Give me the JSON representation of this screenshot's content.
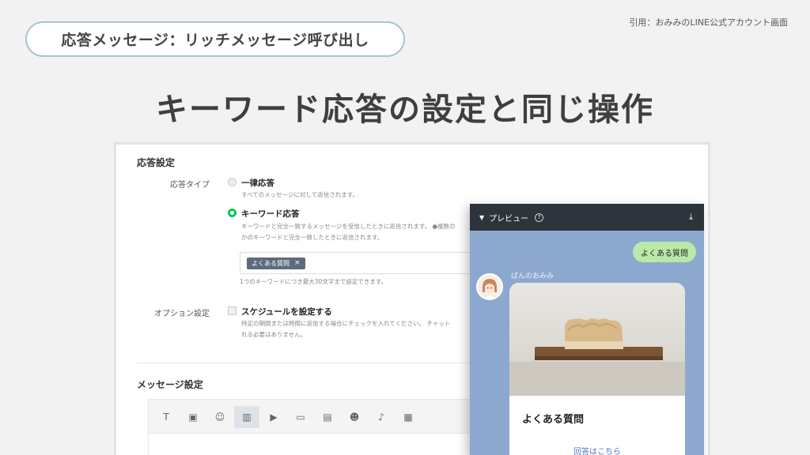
{
  "slide": {
    "pill_text": "応答メッセージ：リッチメッセージ呼び出し",
    "citation": "引用：おみみのLINE公式アカウント画面",
    "headline": "キーワード応答の設定と同じ操作"
  },
  "settings": {
    "response_section_title": "応答設定",
    "response_type_label": "応答タイプ",
    "options": [
      {
        "label": "一律応答",
        "selected": false,
        "description": "すべてのメッセージに対して返信されます。"
      },
      {
        "label": "キーワード応答",
        "selected": true,
        "description_line1": "キーワードと完全一致するメッセージを受信したときに返信されます。 ●複数の",
        "description_line2": "かのキーワードと完全一致したときに返信されます。"
      }
    ],
    "keyword_tag": "よくある質問",
    "keyword_tag_remove": "×",
    "keyword_hint": "1つのキーワードにつき最大30文字まで設定できます。",
    "option_settings_label": "オプション設定",
    "schedule_checkbox_label": "スケジュールを設定する",
    "schedule_checked": false,
    "schedule_desc_line1": "特定の期間または時間に返信する場合にチェックを入れてください。 チャット",
    "schedule_desc_line2": "れる必要はありません。",
    "message_section_title": "メッセージ設定"
  },
  "toolbar": {
    "tools": [
      {
        "icon": "text-icon",
        "glyph": "T"
      },
      {
        "icon": "image-icon",
        "glyph": "▣"
      },
      {
        "icon": "sticker-icon",
        "glyph": "☺"
      },
      {
        "icon": "rich-message-icon",
        "glyph": "▥",
        "active": true
      },
      {
        "icon": "video-icon",
        "glyph": "▶"
      },
      {
        "icon": "card-message-icon",
        "glyph": "▭"
      },
      {
        "icon": "rich-video-icon",
        "glyph": "▤"
      },
      {
        "icon": "emoji-icon",
        "glyph": "☻"
      },
      {
        "icon": "voice-icon",
        "glyph": "♪"
      },
      {
        "icon": "coupon-icon",
        "glyph": "▦"
      }
    ]
  },
  "preview": {
    "title": "プレビュー",
    "help_glyph": "?",
    "download_glyph": "⤓",
    "user_message": "よくある質問",
    "sender_name": "ぱんのおみみ",
    "card_title": "よくある質問",
    "card_link": "回答はこちら"
  },
  "colors": {
    "accent_green": "#06c755",
    "preview_bg": "#8da8cf",
    "preview_header": "#2e343c",
    "user_bubble": "#b9e9a8",
    "tag_bg": "#5c6c7c",
    "link_blue": "#4a76c4"
  }
}
